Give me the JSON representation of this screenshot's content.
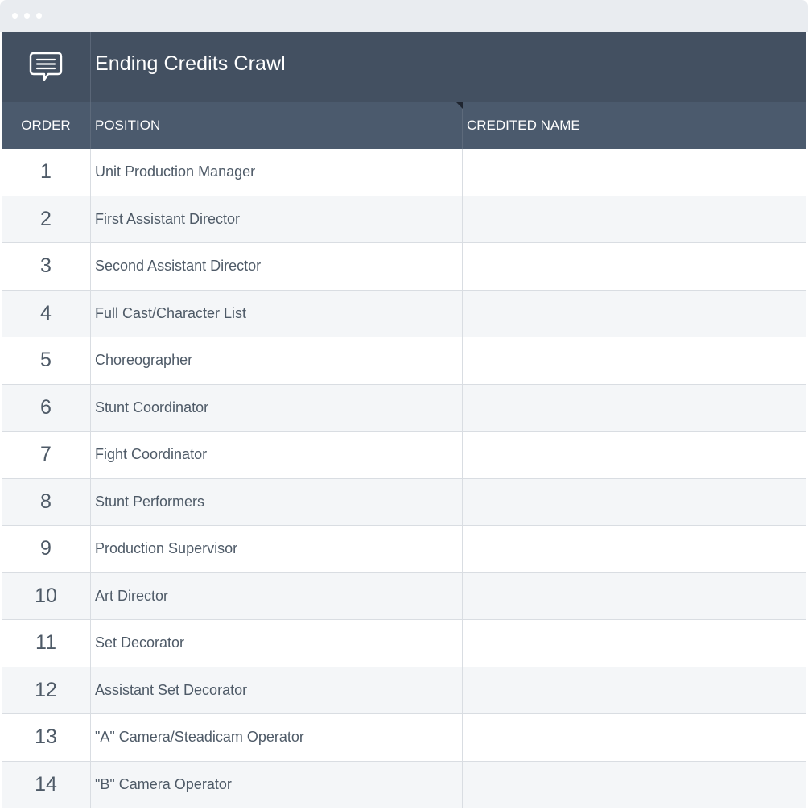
{
  "window": {
    "controls": [
      "window-dot",
      "window-dot",
      "window-dot"
    ]
  },
  "banner": {
    "icon": "chat-bubble-icon",
    "title": "Ending Credits Crawl"
  },
  "table": {
    "columns": [
      "ORDER",
      "POSITION",
      "CREDITED NAME"
    ],
    "rows": [
      {
        "order": "1",
        "position": "Unit Production Manager",
        "credited_name": ""
      },
      {
        "order": "2",
        "position": "First Assistant Director",
        "credited_name": ""
      },
      {
        "order": "3",
        "position": "Second Assistant Director",
        "credited_name": ""
      },
      {
        "order": "4",
        "position": "Full Cast/Character List",
        "credited_name": ""
      },
      {
        "order": "5",
        "position": "Choreographer",
        "credited_name": ""
      },
      {
        "order": "6",
        "position": "Stunt Coordinator",
        "credited_name": ""
      },
      {
        "order": "7",
        "position": "Fight Coordinator",
        "credited_name": ""
      },
      {
        "order": "8",
        "position": "Stunt Performers",
        "credited_name": ""
      },
      {
        "order": "9",
        "position": "Production Supervisor",
        "credited_name": ""
      },
      {
        "order": "10",
        "position": "Art Director",
        "credited_name": ""
      },
      {
        "order": "11",
        "position": "Set Decorator",
        "credited_name": ""
      },
      {
        "order": "12",
        "position": "Assistant Set Decorator",
        "credited_name": ""
      },
      {
        "order": "13",
        "position": "\"A\" Camera/Steadicam Operator",
        "credited_name": ""
      },
      {
        "order": "14",
        "position": "\"B\" Camera Operator",
        "credited_name": ""
      }
    ]
  },
  "colors": {
    "banner_bg": "#435061",
    "header_bg": "#4b5a6d",
    "row_alt_bg": "#f4f6f8",
    "text": "#4e5a67"
  }
}
